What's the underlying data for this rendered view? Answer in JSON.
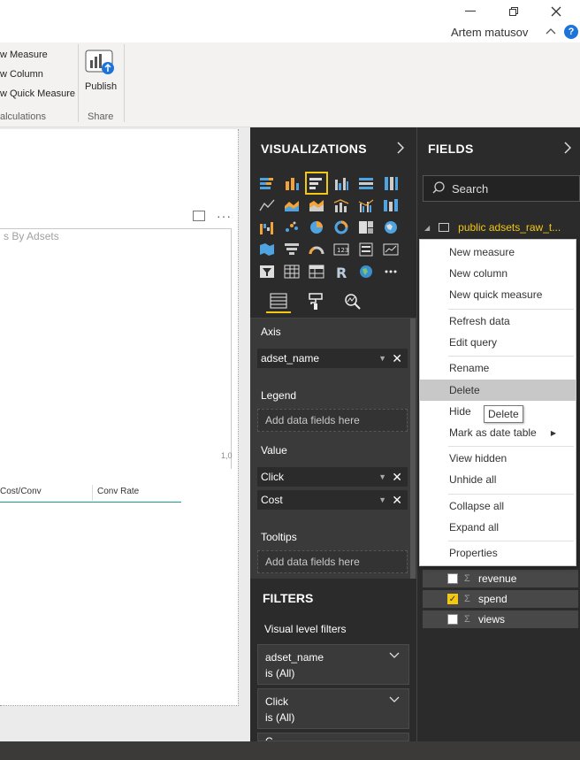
{
  "window": {
    "user_name": "Artem matusov",
    "help_glyph": "?",
    "minimize_icon": "minimize-icon",
    "restore_icon": "restore-icon",
    "close_icon": "close-icon"
  },
  "ribbon": {
    "items": [
      "w Measure",
      "w Column",
      "w Quick Measure"
    ],
    "calc_group_label": "alculations",
    "publish_label": "Publish",
    "share_group_label": "Share"
  },
  "canvas": {
    "chart_title": "s By Adsets",
    "axis_tick": "1,0",
    "table_headers": [
      "Cost/Conv",
      "Conv Rate"
    ]
  },
  "visualizations": {
    "title": "VISUALIZATIONS",
    "icons": [
      "stacked-bar-icon",
      "stacked-column-icon",
      "clustered-bar-icon",
      "clustered-column-icon",
      "100-bar-icon",
      "100-column-icon",
      "line-chart-icon",
      "area-chart-icon",
      "stacked-area-icon",
      "line-column-icon",
      "line-clustered-icon",
      "ribbon-chart-icon",
      "waterfall-icon",
      "scatter-icon",
      "pie-icon",
      "donut-icon",
      "treemap-icon",
      "map-icon",
      "filled-map-icon",
      "funnel-icon",
      "gauge-icon",
      "card-icon",
      "multirow-card-icon",
      "kpi-icon",
      "slicer-icon",
      "table-icon",
      "matrix-icon",
      "r-visual-icon",
      "globe-icon",
      "more-icon"
    ],
    "wells": {
      "axis_label": "Axis",
      "axis_field": "adset_name",
      "legend_label": "Legend",
      "legend_placeholder": "Add data fields here",
      "value_label": "Value",
      "value_fields": [
        "Click",
        "Cost"
      ],
      "tooltips_label": "Tooltips",
      "tooltips_placeholder": "Add data fields here"
    },
    "filters": {
      "title": "FILTERS",
      "subtitle": "Visual level filters",
      "cards": [
        {
          "name": "adset_name",
          "state": "is (All)"
        },
        {
          "name": "Click",
          "state": "is (All)"
        },
        {
          "name": "C",
          "state": ""
        }
      ]
    }
  },
  "fields": {
    "title": "FIELDS",
    "search_placeholder": "Search",
    "table_name": "public adsets_raw_t...",
    "rows": [
      {
        "name": "revenue",
        "checked": false
      },
      {
        "name": "spend",
        "checked": true
      },
      {
        "name": "views",
        "checked": false
      }
    ]
  },
  "context_menu": {
    "items": [
      "New measure",
      "New column",
      "New quick measure",
      "Refresh data",
      "Edit query",
      "Rename",
      "Delete",
      "Hide",
      "Mark as date table",
      "View hidden",
      "Unhide all",
      "Collapse all",
      "Expand all",
      "Properties"
    ],
    "hovered": "Delete",
    "tooltip": "Delete"
  },
  "colors": {
    "accent": "#f2c811",
    "pane_bg": "#2b2b2b",
    "help_blue": "#1e73d8"
  }
}
